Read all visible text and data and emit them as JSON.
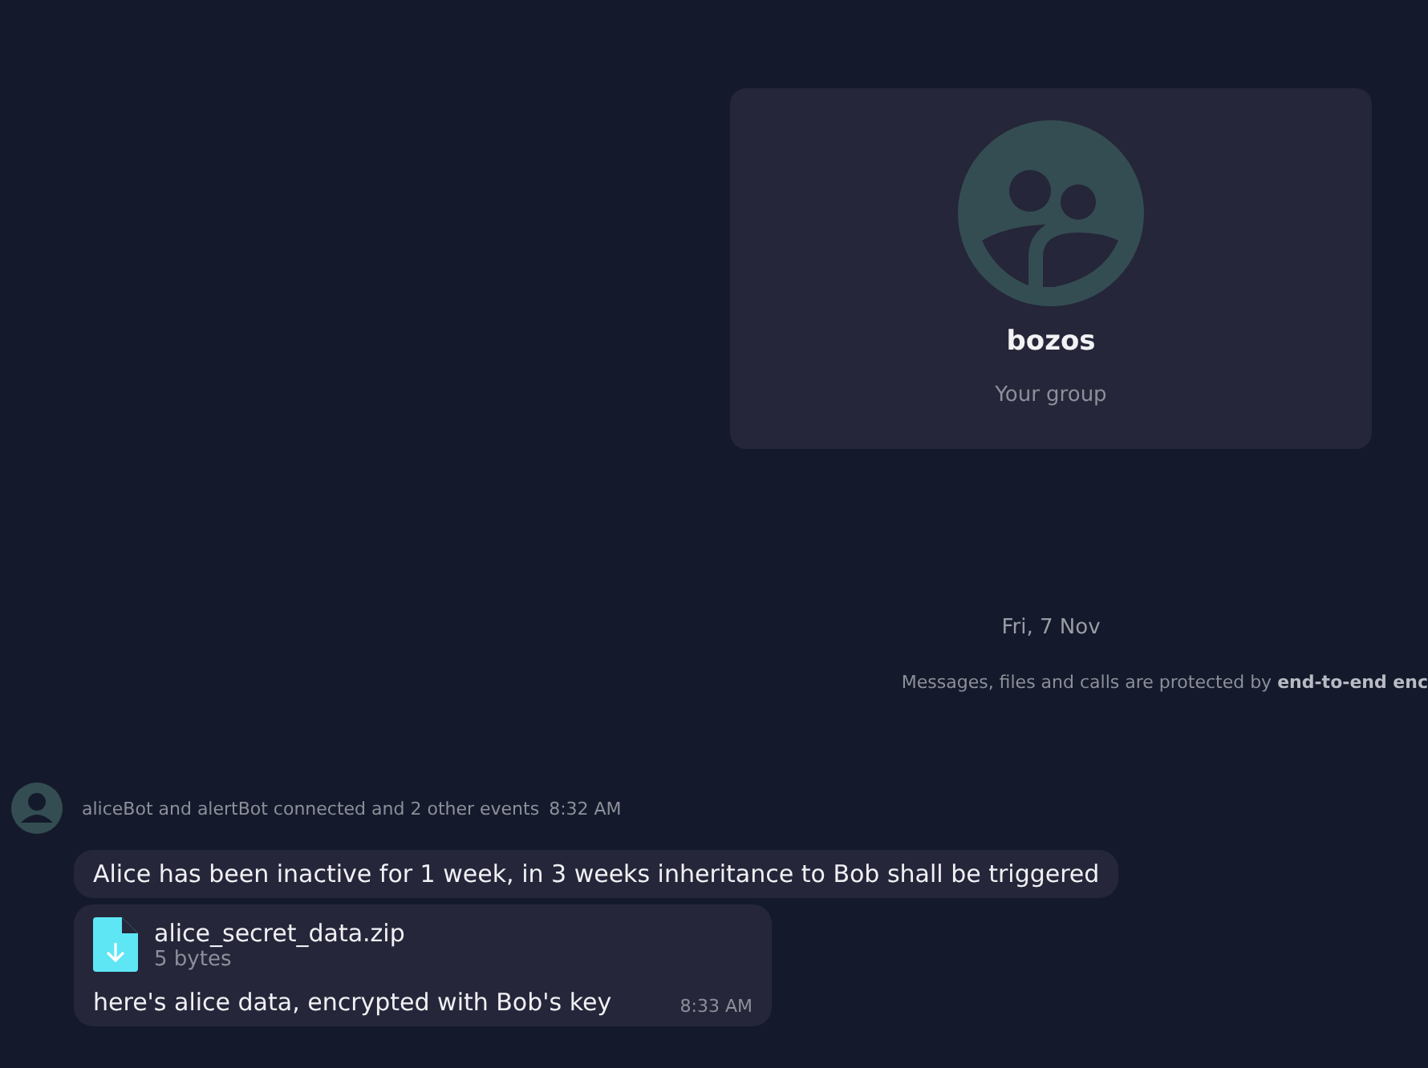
{
  "group_card": {
    "name": "bozos",
    "subtitle": "Your group"
  },
  "date_separator": "Fri, 7 Nov",
  "encryption_notice": "Messages, files and calls are protected by **end-to-end enc**",
  "event": {
    "text": "aliceBot and alertBot connected and 2 other events",
    "time": "8:32 AM"
  },
  "messages": [
    {
      "kind": "text",
      "text": "Alice has been inactive for 1 week, in 3 weeks inheritance to Bob shall be triggered"
    },
    {
      "kind": "file",
      "file_name": "alice_secret_data.zip",
      "file_size": "5 bytes",
      "text": "here's alice data, encrypted with Bob's key",
      "time": "8:33 AM"
    }
  ]
}
